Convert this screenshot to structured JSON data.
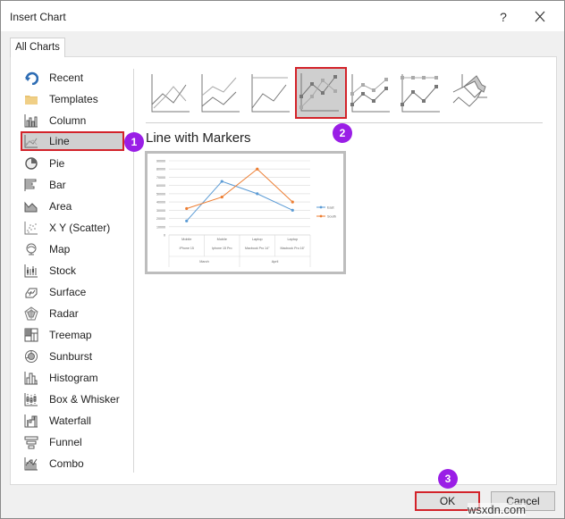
{
  "window": {
    "title": "Insert Chart",
    "help_label": "?",
    "close_icon": "close-icon"
  },
  "tabs": [
    {
      "label": "All Charts",
      "selected": true
    }
  ],
  "sidebar": {
    "items": [
      {
        "label": "Recent",
        "icon": "recent-icon"
      },
      {
        "label": "Templates",
        "icon": "folder-icon"
      },
      {
        "label": "Column",
        "icon": "column-chart-icon"
      },
      {
        "label": "Line",
        "icon": "line-chart-icon",
        "selected": true
      },
      {
        "label": "Pie",
        "icon": "pie-chart-icon"
      },
      {
        "label": "Bar",
        "icon": "bar-chart-icon"
      },
      {
        "label": "Area",
        "icon": "area-chart-icon"
      },
      {
        "label": "X Y (Scatter)",
        "icon": "scatter-chart-icon"
      },
      {
        "label": "Map",
        "icon": "map-chart-icon"
      },
      {
        "label": "Stock",
        "icon": "stock-chart-icon"
      },
      {
        "label": "Surface",
        "icon": "surface-chart-icon"
      },
      {
        "label": "Radar",
        "icon": "radar-chart-icon"
      },
      {
        "label": "Treemap",
        "icon": "treemap-chart-icon"
      },
      {
        "label": "Sunburst",
        "icon": "sunburst-chart-icon"
      },
      {
        "label": "Histogram",
        "icon": "histogram-chart-icon"
      },
      {
        "label": "Box & Whisker",
        "icon": "box-whisker-chart-icon"
      },
      {
        "label": "Waterfall",
        "icon": "waterfall-chart-icon"
      },
      {
        "label": "Funnel",
        "icon": "funnel-chart-icon"
      },
      {
        "label": "Combo",
        "icon": "combo-chart-icon"
      }
    ]
  },
  "subtypes": [
    {
      "name": "Line",
      "icon": "line-subtype-icon"
    },
    {
      "name": "Stacked Line",
      "icon": "stacked-line-subtype-icon"
    },
    {
      "name": "100% Stacked Line",
      "icon": "percent-stacked-line-subtype-icon"
    },
    {
      "name": "Line with Markers",
      "icon": "line-markers-subtype-icon",
      "selected": true
    },
    {
      "name": "Stacked Line with Markers",
      "icon": "stacked-line-markers-subtype-icon"
    },
    {
      "name": "100% Stacked Line with Markers",
      "icon": "percent-stacked-line-markers-subtype-icon"
    },
    {
      "name": "3-D Line",
      "icon": "3d-line-subtype-icon"
    }
  ],
  "preview": {
    "title": "Line with Markers"
  },
  "badges": [
    "1",
    "2",
    "3"
  ],
  "buttons": {
    "ok": "OK",
    "cancel": "Cancel"
  },
  "watermark": "wsxdn.com",
  "colors": {
    "highlight_border": "#d3232a",
    "badge": "#9a1ee6",
    "series_east": "#5b9bd5",
    "series_south": "#ed7d31"
  },
  "chart_data": {
    "type": "line",
    "title": "",
    "categories": [
      {
        "item": "Mobile",
        "model": "iPhone 15",
        "month": "March"
      },
      {
        "item": "Mobile",
        "model": "Iphone 15 Pro",
        "month": "March"
      },
      {
        "item": "Laptop",
        "model": "Macbook Pro 14\"",
        "month": "April"
      },
      {
        "item": "Laptop",
        "model": "Macbook Pro 16\"",
        "month": "April"
      }
    ],
    "group_labels": [
      "March",
      "April"
    ],
    "series": [
      {
        "name": "East",
        "values": [
          17000,
          65000,
          50000,
          30000
        ],
        "color": "#5b9bd5"
      },
      {
        "name": "South",
        "values": [
          32000,
          46000,
          80000,
          40000
        ],
        "color": "#ed7d31"
      }
    ],
    "ylim": [
      0,
      90000
    ],
    "yticks": [
      "0",
      "10000",
      "20000",
      "30000",
      "40000",
      "50000",
      "60000",
      "70000",
      "80000",
      "90000"
    ],
    "grid": true,
    "legend": "right",
    "markers": true
  }
}
